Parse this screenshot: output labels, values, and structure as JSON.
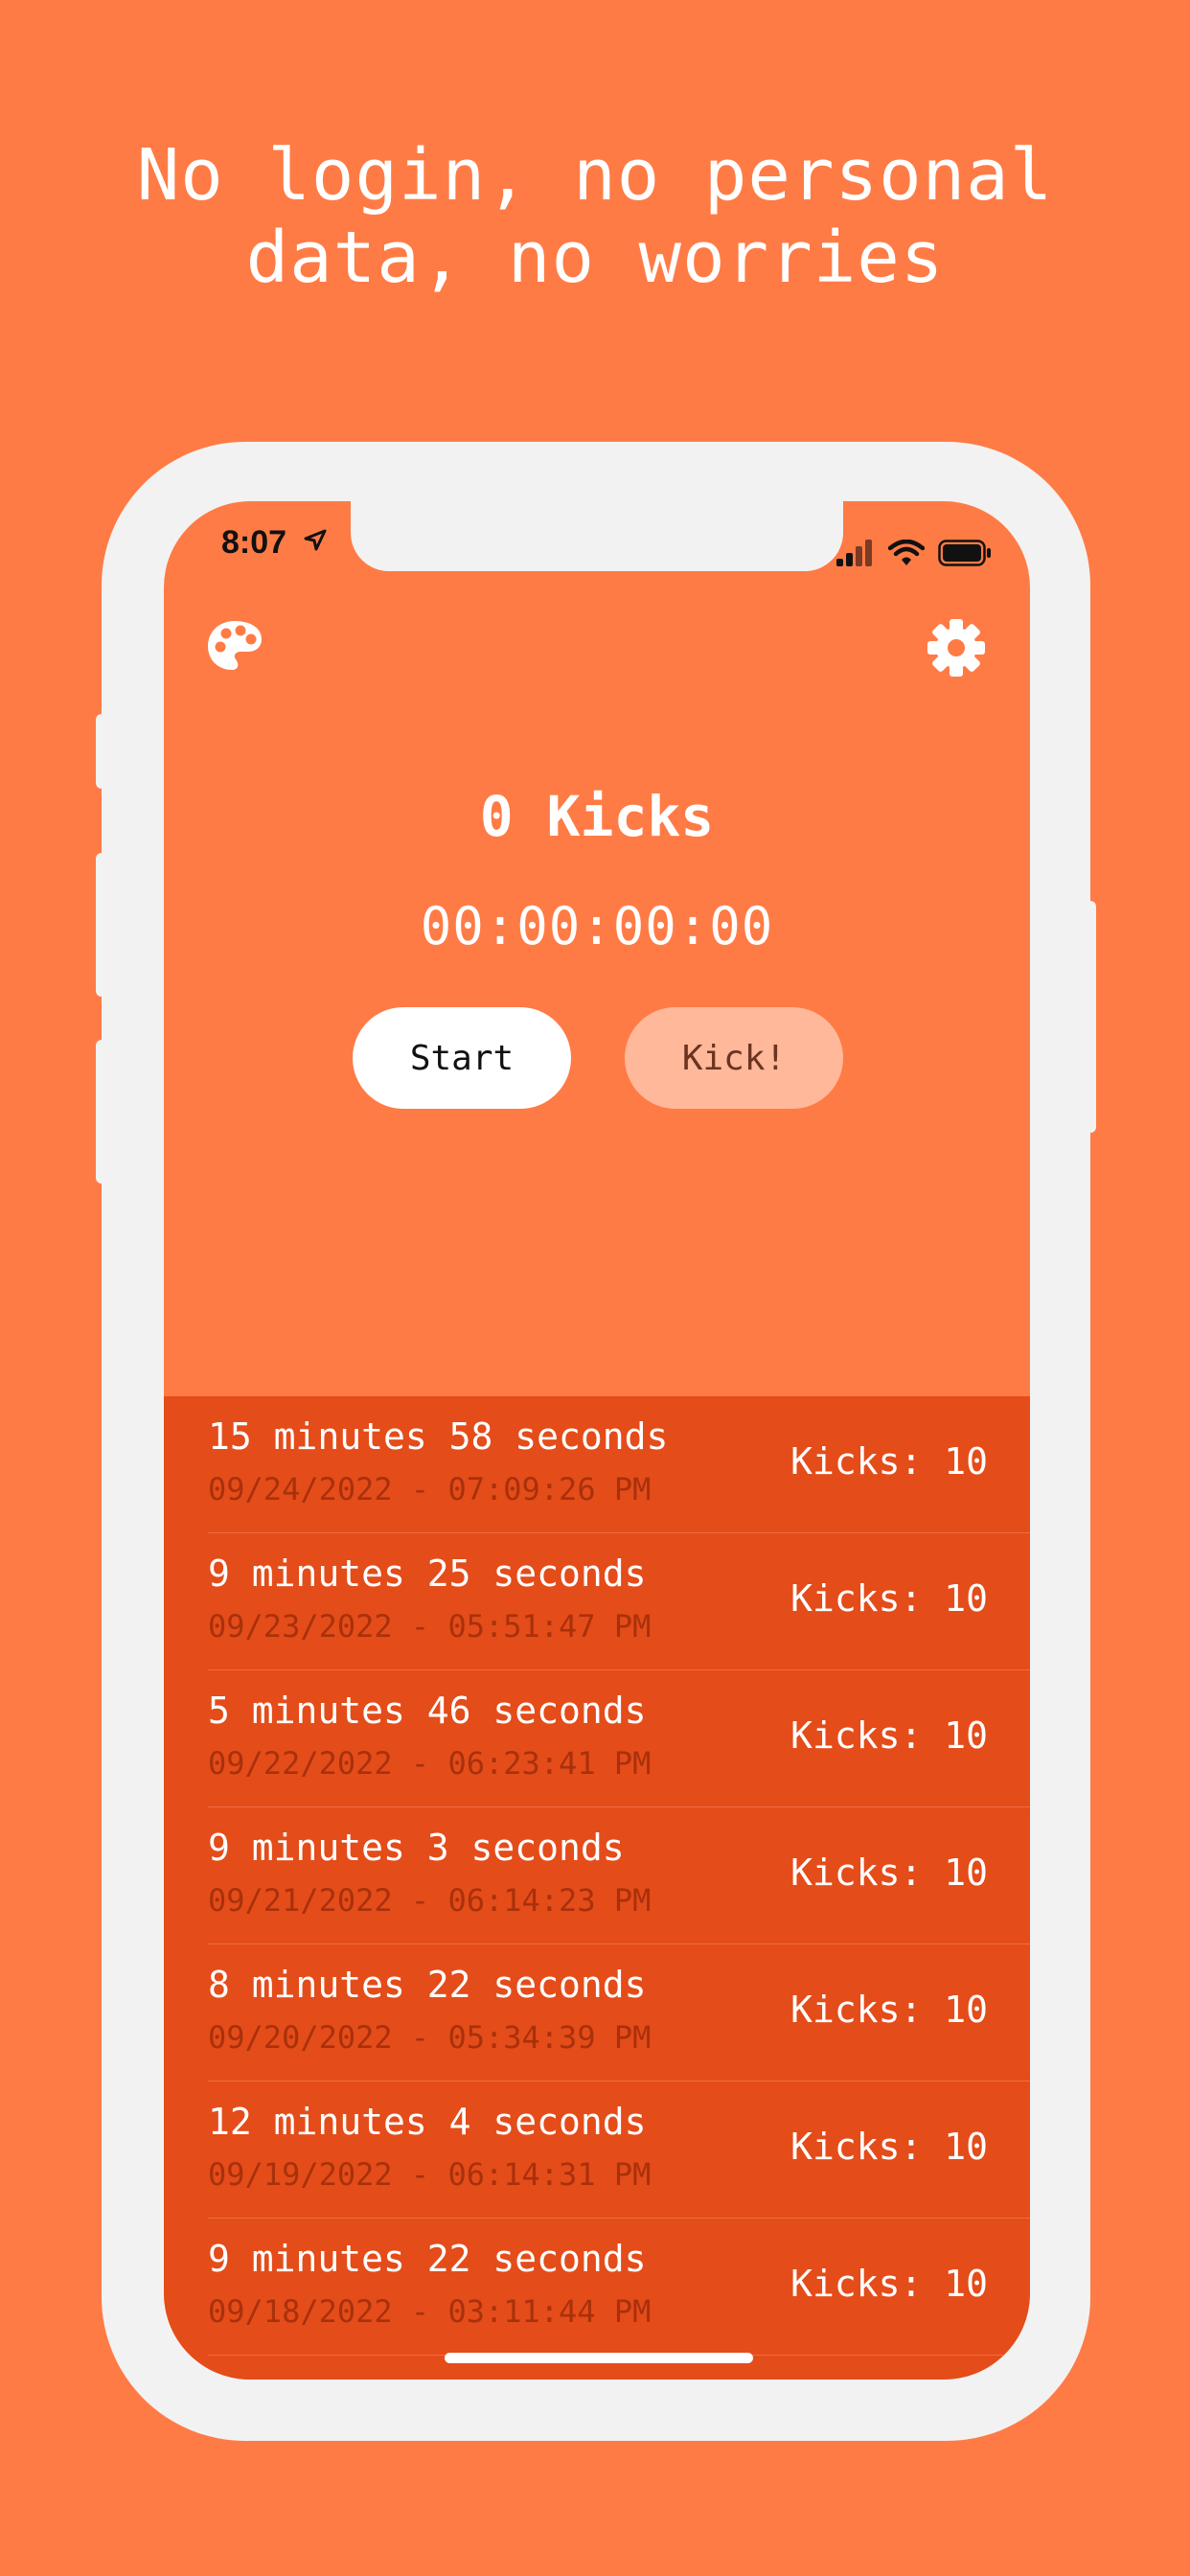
{
  "headline": {
    "line1": "No login, no personal",
    "line2": "data, no worries"
  },
  "status_bar": {
    "time": "8:07",
    "icons": [
      "location-arrow-icon",
      "signal-icon",
      "wifi-icon",
      "battery-icon"
    ]
  },
  "toolbar": {
    "left_icon": "palette-icon",
    "right_icon": "gear-icon"
  },
  "counter": {
    "kicks_label": "0 Kicks",
    "timer": "00:00:00:00"
  },
  "buttons": {
    "start_label": "Start",
    "kick_label": "Kick!"
  },
  "history": [
    {
      "duration": "15 minutes 58 seconds",
      "datetime": "09/24/2022 - 07:09:26 PM",
      "kicks": "Kicks: 10"
    },
    {
      "duration": "9 minutes 25 seconds",
      "datetime": "09/23/2022 - 05:51:47 PM",
      "kicks": "Kicks: 10"
    },
    {
      "duration": "5 minutes 46 seconds",
      "datetime": "09/22/2022 - 06:23:41 PM",
      "kicks": "Kicks: 10"
    },
    {
      "duration": "9 minutes 3 seconds",
      "datetime": "09/21/2022 - 06:14:23 PM",
      "kicks": "Kicks: 10"
    },
    {
      "duration": "8 minutes 22 seconds",
      "datetime": "09/20/2022 - 05:34:39 PM",
      "kicks": "Kicks: 10"
    },
    {
      "duration": "12 minutes 4 seconds",
      "datetime": "09/19/2022 - 06:14:31 PM",
      "kicks": "Kicks: 10"
    },
    {
      "duration": "9 minutes 22 seconds",
      "datetime": "09/18/2022 - 03:11:44 PM",
      "kicks": "Kicks: 10"
    }
  ],
  "colors": {
    "background": "#ff7b45",
    "history_background": "#e44c1a",
    "device_frame": "#f3f2f2",
    "kick_button": "#ffb89a"
  }
}
